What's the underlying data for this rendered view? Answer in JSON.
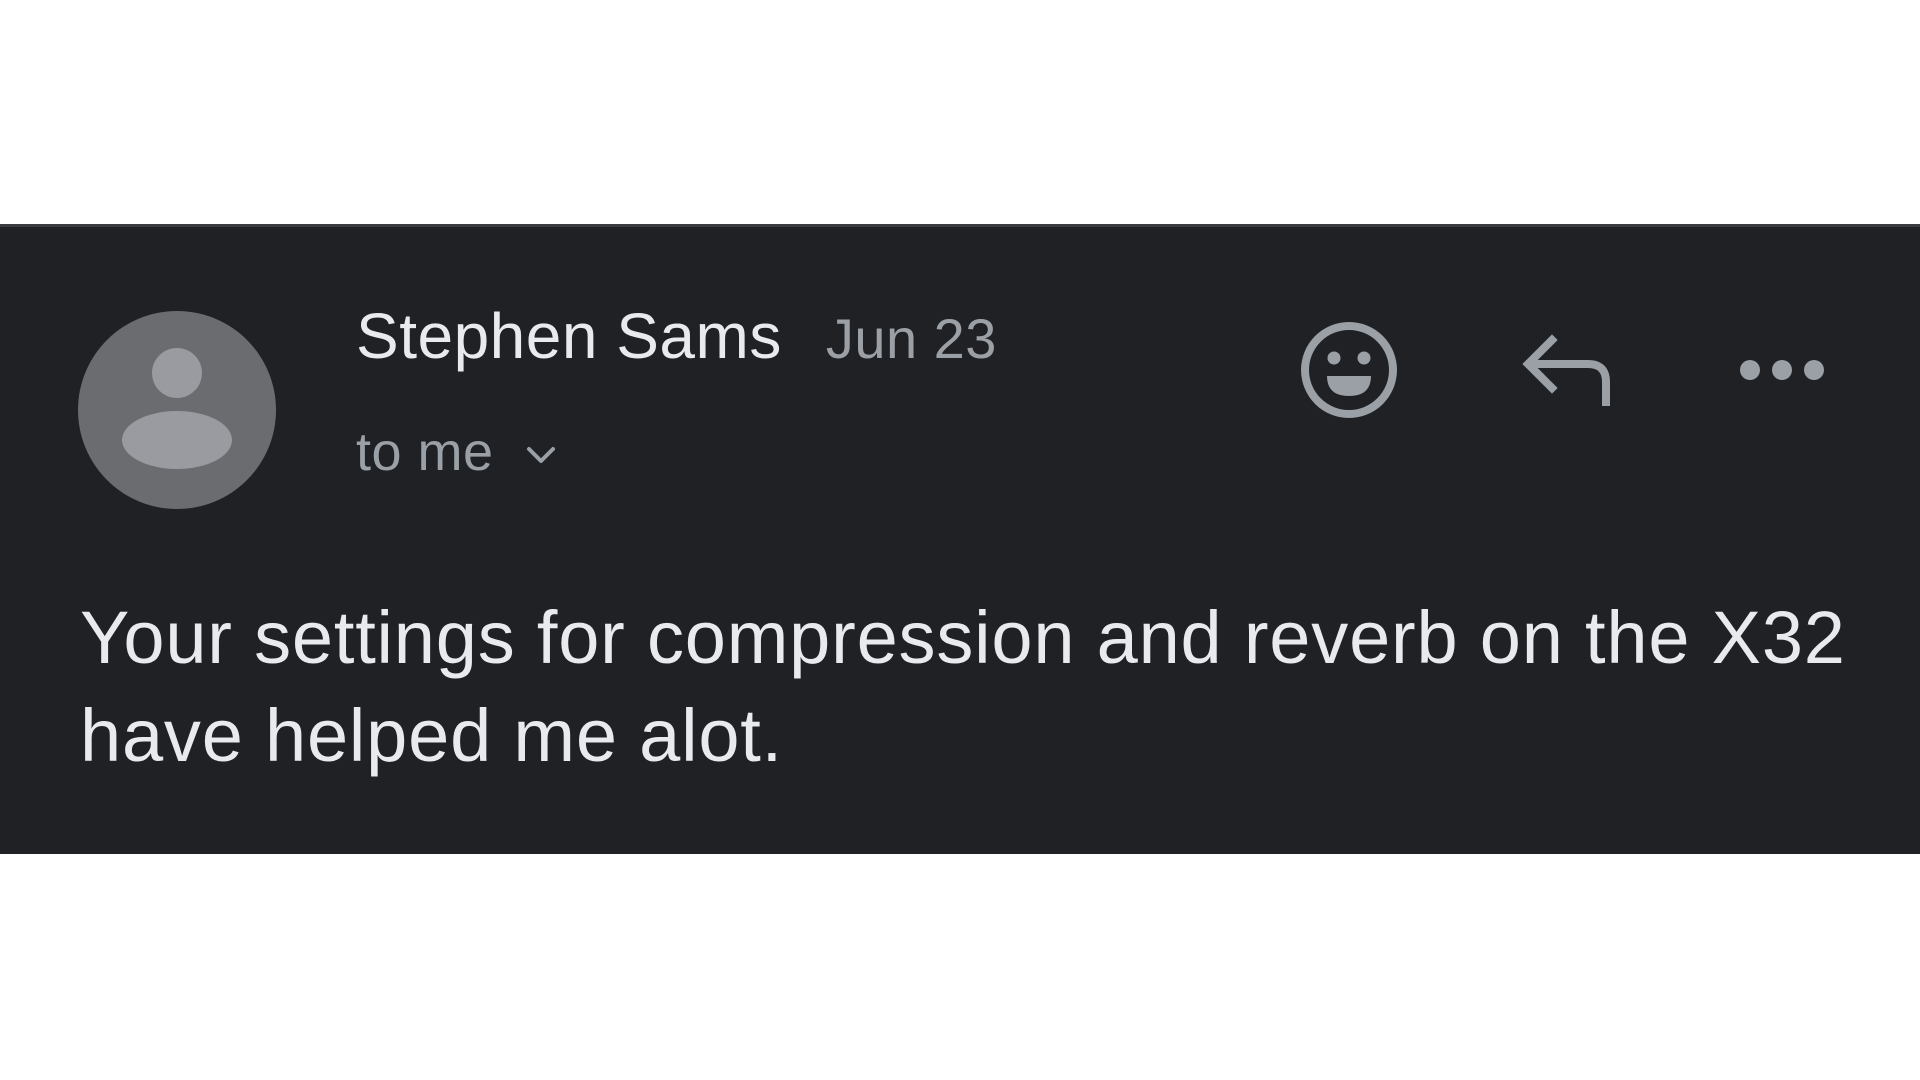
{
  "email": {
    "sender_name": "Stephen Sams",
    "date": "Jun 23",
    "recipient": "to me",
    "body": "Your settings for compression and reverb on the X32 have helped me alot."
  },
  "icons": {
    "avatar": "person-avatar-icon",
    "recipient_toggle": "chevron-down-icon",
    "emoji": "smiley-face-icon",
    "reply": "reply-arrow-icon",
    "more": "more-horizontal-icon"
  },
  "colors": {
    "background": "#202124",
    "primary_text": "#e8eaed",
    "secondary_text": "#9aa0a6",
    "avatar_bg": "#6b6c70",
    "avatar_fg": "#9a9ba0"
  }
}
